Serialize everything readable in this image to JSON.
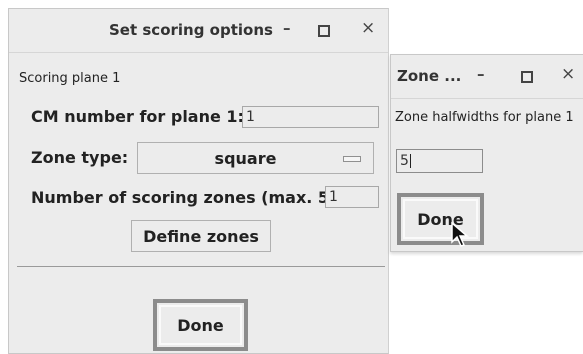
{
  "dialog1": {
    "title": "Set scoring options",
    "minimize": "–",
    "close": "×",
    "scoring_plane_label": "Scoring plane 1",
    "cm_label": "CM number for plane 1:",
    "cm_value": "1",
    "zone_type_label": "Zone type:",
    "zone_type_value": "square",
    "num_zones_label": "Number of scoring zones (max. 5:",
    "num_zones_value": "1",
    "define_zones": "Define zones",
    "done": "Done"
  },
  "dialog2": {
    "title": "Zone ...",
    "minimize": "–",
    "close": "×",
    "halfwidths_label": "Zone halfwidths for plane 1",
    "halfwidth_value": "5",
    "done": "Done"
  },
  "colors": {
    "background": "#ececec",
    "frame": "#8c8c8c"
  }
}
